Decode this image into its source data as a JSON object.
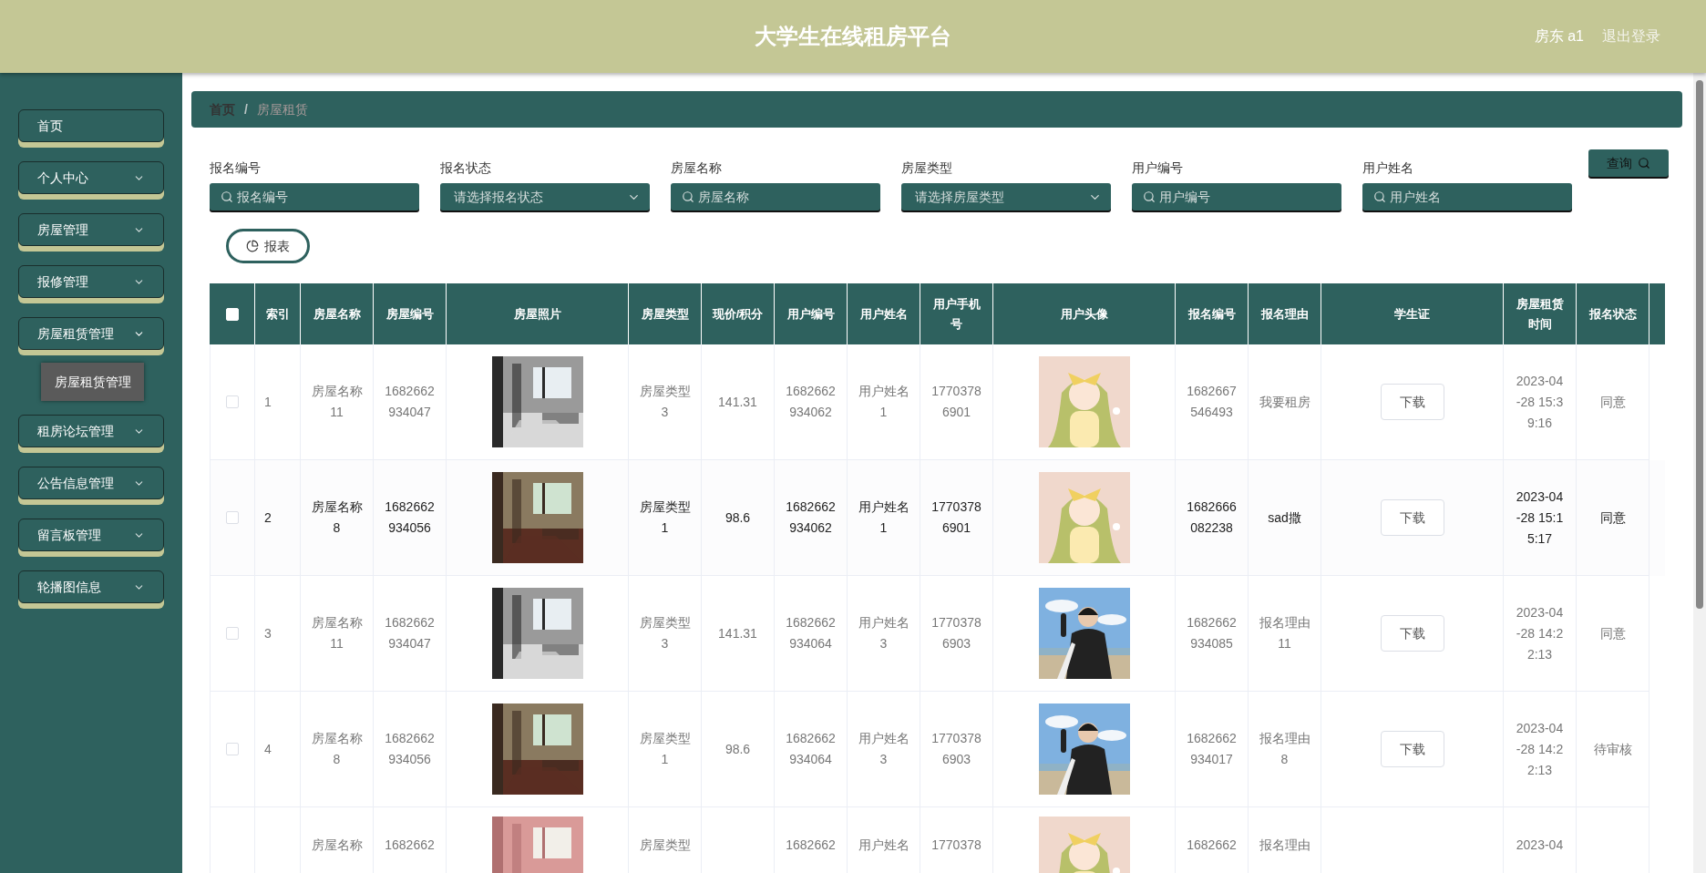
{
  "header": {
    "title": "大学生在线租房平台",
    "user": "房东 a1",
    "logout": "退出登录"
  },
  "sidebar": {
    "items": [
      {
        "label": "首页",
        "kind": "link"
      },
      {
        "label": "个人中心",
        "kind": "menu",
        "expanded": false
      },
      {
        "label": "房屋管理",
        "kind": "menu",
        "expanded": false
      },
      {
        "label": "报修管理",
        "kind": "menu",
        "expanded": false
      },
      {
        "label": "房屋租赁管理",
        "kind": "menu",
        "expanded": true,
        "children": [
          {
            "label": "房屋租赁管理",
            "selected": true
          }
        ]
      },
      {
        "label": "租房论坛管理",
        "kind": "menu",
        "expanded": false
      },
      {
        "label": "公告信息管理",
        "kind": "menu",
        "expanded": false
      },
      {
        "label": "留言板管理",
        "kind": "menu",
        "expanded": false
      },
      {
        "label": "轮播图信息",
        "kind": "menu",
        "expanded": false
      }
    ]
  },
  "breadcrumb": {
    "separator": "/",
    "items": [
      {
        "label": "首页",
        "current": false
      },
      {
        "label": "房屋租赁",
        "current": true
      }
    ]
  },
  "filters": [
    {
      "label": "报名编号",
      "placeholder": "报名编号",
      "kind": "search"
    },
    {
      "label": "报名状态",
      "placeholder": "请选择报名状态",
      "kind": "select"
    },
    {
      "label": "房屋名称",
      "placeholder": "房屋名称",
      "kind": "search"
    },
    {
      "label": "房屋类型",
      "placeholder": "请选择房屋类型",
      "kind": "select"
    },
    {
      "label": "用户编号",
      "placeholder": "用户编号",
      "kind": "search"
    },
    {
      "label": "用户姓名",
      "placeholder": "用户姓名",
      "kind": "search"
    }
  ],
  "query_button": "查询",
  "report_button": "报表",
  "table": {
    "select_all": {
      "checked": false
    },
    "columns": [
      "索引",
      "房屋名称",
      "房屋编号",
      "房屋照片",
      "房屋类型",
      "现价/积分",
      "用户编号",
      "用户姓名",
      "用户手机号",
      "用户头像",
      "报名编号",
      "报名理由",
      "学生证",
      "房屋租赁时间",
      "报名状态"
    ],
    "rows": [
      {
        "checked": false,
        "highlighted": false,
        "index": "1",
        "house_name": "房屋名称11",
        "house_no": "1682662934047",
        "house_type": "房屋类型3",
        "price": "141.31",
        "user_no": "1682662934062",
        "user_name": "用户姓名1",
        "phone": "17703786901",
        "apply_no": "1682667546493",
        "reason": "我要租房",
        "student_card": "下载",
        "rent_time": "2023-04-28 15:39:16",
        "status": "同意"
      },
      {
        "checked": false,
        "highlighted": true,
        "index": "2",
        "house_name": "房屋名称8",
        "house_no": "1682662934056",
        "house_type": "房屋类型1",
        "price": "98.6",
        "user_no": "1682662934062",
        "user_name": "用户姓名1",
        "phone": "17703786901",
        "apply_no": "1682666082238",
        "reason": "sad撒",
        "student_card": "下载",
        "rent_time": "2023-04-28 15:15:17",
        "status": "同意"
      },
      {
        "checked": false,
        "highlighted": false,
        "index": "3",
        "house_name": "房屋名称11",
        "house_no": "1682662934047",
        "house_type": "房屋类型3",
        "price": "141.31",
        "user_no": "1682662934064",
        "user_name": "用户姓名3",
        "phone": "17703786903",
        "apply_no": "1682662934085",
        "reason": "报名理由11",
        "student_card": "下载",
        "rent_time": "2023-04-28 14:22:13",
        "status": "同意"
      },
      {
        "checked": false,
        "highlighted": false,
        "index": "4",
        "house_name": "房屋名称8",
        "house_no": "1682662934056",
        "house_type": "房屋类型1",
        "price": "98.6",
        "user_no": "1682662934064",
        "user_name": "用户姓名3",
        "phone": "17703786903",
        "apply_no": "1682662934017",
        "reason": "报名理由8",
        "student_card": "下载",
        "rent_time": "2023-04-28 14:22:13",
        "status": "待审核"
      },
      {
        "highlighted": false,
        "house_name": "房屋名称",
        "house_no": "1682662",
        "house_type": "房屋类型",
        "user_no": "1682662",
        "user_name": "用户姓名",
        "phone": "1770378",
        "apply_no": "1682662",
        "reason": "报名理由",
        "rent_time": "2023-04"
      }
    ]
  }
}
